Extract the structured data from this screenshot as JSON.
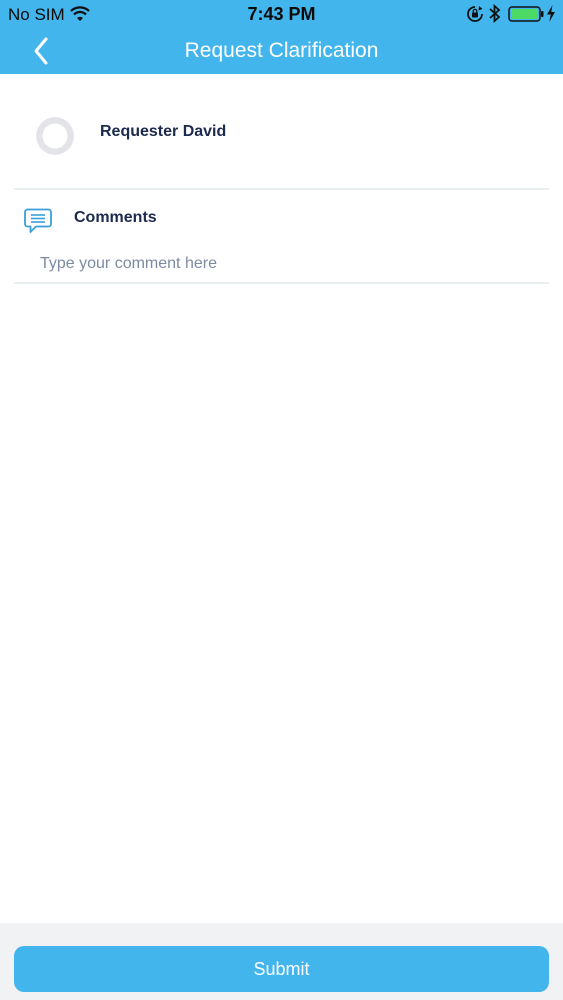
{
  "status_bar": {
    "carrier": "No SIM",
    "time": "7:43 PM",
    "icons": [
      "wifi-icon",
      "orientation-lock-icon",
      "bluetooth-icon",
      "battery-icon",
      "charging-bolt-icon"
    ]
  },
  "header": {
    "title": "Request Clarification",
    "back_icon": "chevron-left-icon",
    "color": "#42b5ec"
  },
  "requester": {
    "avatar_icon": "user-avatar-placeholder",
    "name": "Requester David"
  },
  "comments": {
    "icon": "comment-bubble-icon",
    "label": "Comments",
    "value": "",
    "placeholder": "Type your comment here"
  },
  "footer": {
    "submit_label": "Submit",
    "button_color": "#42b5ec"
  }
}
